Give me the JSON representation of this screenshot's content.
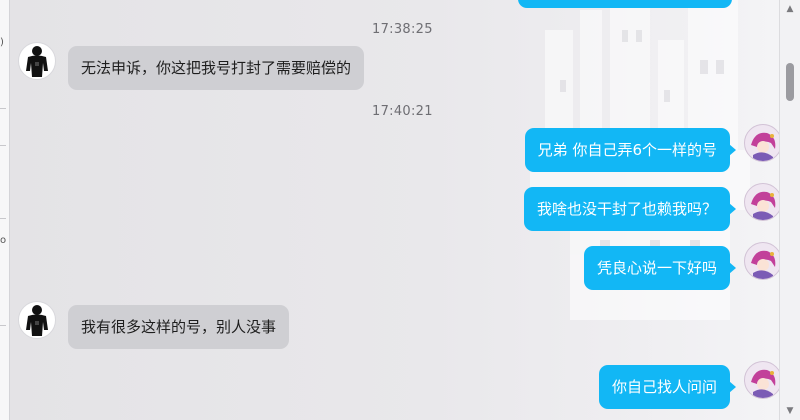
{
  "conversation": {
    "messages": [
      {
        "type": "timestamp",
        "text": "17:38:25"
      },
      {
        "type": "incoming",
        "text": "无法申诉，你这把我号打封了需要赔偿的"
      },
      {
        "type": "timestamp",
        "text": "17:40:21"
      },
      {
        "type": "outgoing",
        "text": "兄弟 你自己弄6个一样的号"
      },
      {
        "type": "outgoing",
        "text": "我啥也没干封了也赖我吗？"
      },
      {
        "type": "outgoing",
        "text": "凭良心说一下好吗"
      },
      {
        "type": "incoming",
        "text": "我有很多这样的号，别人没事"
      },
      {
        "type": "outgoing",
        "text": "你自己找人问问"
      }
    ]
  },
  "colors": {
    "outgoing_bubble": "#12b7f5",
    "incoming_bubble": "#cfcfd3",
    "chat_background": "#e9e8eb"
  },
  "icons": {
    "contact_avatar": "dark-silhouette-avatar-icon",
    "my_avatar": "anime-character-avatar-icon",
    "scroll_up": "triangle-up-icon",
    "scroll_down": "triangle-down-icon"
  }
}
